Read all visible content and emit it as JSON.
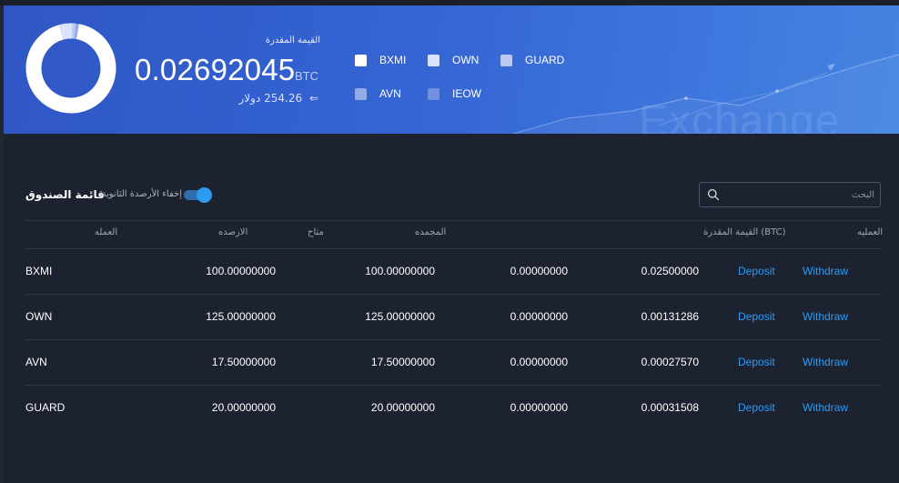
{
  "header": {
    "estimated_label": "القيمة المقدرة",
    "total_value": "0.02692045",
    "total_unit": "BTC",
    "fiat_arrow": "⇐",
    "fiat_value": "254.26 دولار",
    "legend": [
      {
        "label": "BXMI",
        "color": "#ffffff"
      },
      {
        "label": "OWN",
        "color": "#d9e3fb"
      },
      {
        "label": "GUARD",
        "color": "#b9c9f1"
      },
      {
        "label": "AVN",
        "color": "#93abe8"
      },
      {
        "label": "IEOW",
        "color": "#7290e0"
      }
    ],
    "background_word": "Exchange"
  },
  "allocation": [
    {
      "asset": "BXMI",
      "share": 0.929
    },
    {
      "asset": "OWN",
      "share": 0.049
    },
    {
      "asset": "GUARD",
      "share": 0.012
    },
    {
      "asset": "AVN",
      "share": 0.01
    }
  ],
  "wallet": {
    "title": "قائمة الصندوق",
    "hide_small_label": "إخفاء الأرصدة الثانوية",
    "hide_small_enabled": true,
    "search_placeholder": "البحث",
    "columns": {
      "currency": "العمله",
      "balance": "الارصده",
      "available": "متاح",
      "frozen": "المجمده",
      "btc_value": "القيمة المقدرة (BTC)",
      "actions": "العمليه"
    },
    "rows": [
      {
        "coin": "BXMI",
        "balance": "100.00000000",
        "frozen": "100.00000000",
        "available": "0.00000000",
        "btc_value": "0.02500000",
        "deposit": "Deposit",
        "withdraw": "Withdraw"
      },
      {
        "coin": "OWN",
        "balance": "125.00000000",
        "frozen": "125.00000000",
        "available": "0.00000000",
        "btc_value": "0.00131286",
        "deposit": "Deposit",
        "withdraw": "Withdraw"
      },
      {
        "coin": "AVN",
        "balance": "17.50000000",
        "frozen": "17.50000000",
        "available": "0.00000000",
        "btc_value": "0.00027570",
        "deposit": "Deposit",
        "withdraw": "Withdraw"
      },
      {
        "coin": "GUARD",
        "balance": "20.00000000",
        "frozen": "20.00000000",
        "available": "0.00000000",
        "btc_value": "0.00031508",
        "deposit": "Deposit",
        "withdraw": "Withdraw"
      }
    ]
  }
}
